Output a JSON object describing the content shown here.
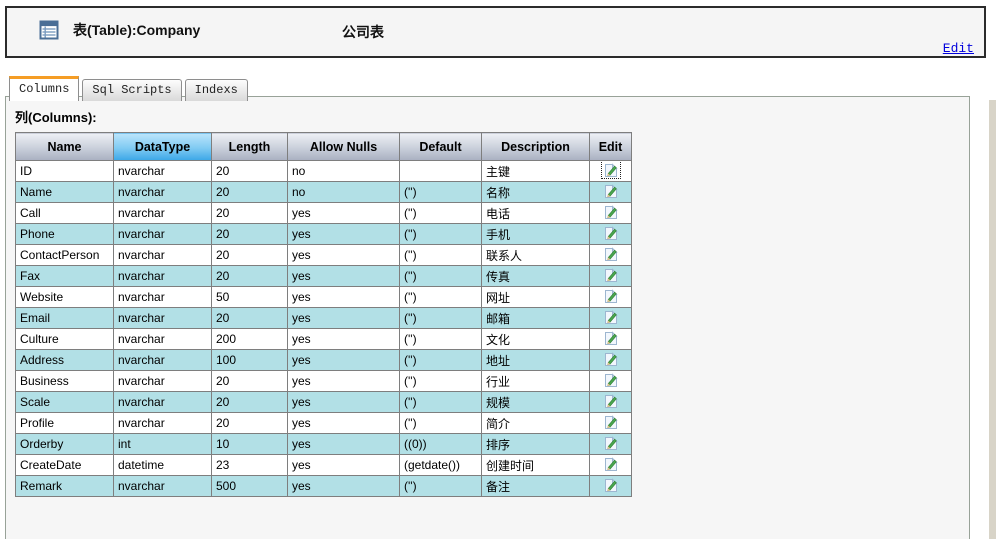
{
  "header": {
    "icon": "table-icon",
    "title": "表(Table):Company",
    "subtitle": "公司表",
    "edit_link": "Edit"
  },
  "tabs": [
    {
      "label": "Columns",
      "active": true
    },
    {
      "label": "Sql Scripts",
      "active": false
    },
    {
      "label": "Indexs",
      "active": false
    }
  ],
  "columns_section": {
    "label": "列(Columns):",
    "table": {
      "headers": [
        "Name",
        "DataType",
        "Length",
        "Allow Nulls",
        "Default",
        "Description",
        "Edit"
      ],
      "highlighted_header": "DataType",
      "focused_edit_row": 0,
      "rows": [
        {
          "name": "ID",
          "datatype": "nvarchar",
          "length": "20",
          "allow_nulls": "no",
          "default": "",
          "description": "主键"
        },
        {
          "name": "Name",
          "datatype": "nvarchar",
          "length": "20",
          "allow_nulls": "no",
          "default": "('')",
          "description": "名称"
        },
        {
          "name": "Call",
          "datatype": "nvarchar",
          "length": "20",
          "allow_nulls": "yes",
          "default": "('')",
          "description": "电话"
        },
        {
          "name": "Phone",
          "datatype": "nvarchar",
          "length": "20",
          "allow_nulls": "yes",
          "default": "('')",
          "description": "手机"
        },
        {
          "name": "ContactPerson",
          "datatype": "nvarchar",
          "length": "20",
          "allow_nulls": "yes",
          "default": "('')",
          "description": "联系人"
        },
        {
          "name": "Fax",
          "datatype": "nvarchar",
          "length": "20",
          "allow_nulls": "yes",
          "default": "('')",
          "description": "传真"
        },
        {
          "name": "Website",
          "datatype": "nvarchar",
          "length": "50",
          "allow_nulls": "yes",
          "default": "('')",
          "description": "网址"
        },
        {
          "name": "Email",
          "datatype": "nvarchar",
          "length": "20",
          "allow_nulls": "yes",
          "default": "('')",
          "description": "邮箱"
        },
        {
          "name": "Culture",
          "datatype": "nvarchar",
          "length": "200",
          "allow_nulls": "yes",
          "default": "('')",
          "description": "文化"
        },
        {
          "name": "Address",
          "datatype": "nvarchar",
          "length": "100",
          "allow_nulls": "yes",
          "default": "('')",
          "description": "地址"
        },
        {
          "name": "Business",
          "datatype": "nvarchar",
          "length": "20",
          "allow_nulls": "yes",
          "default": "('')",
          "description": "行业"
        },
        {
          "name": "Scale",
          "datatype": "nvarchar",
          "length": "20",
          "allow_nulls": "yes",
          "default": "('')",
          "description": "规模"
        },
        {
          "name": "Profile",
          "datatype": "nvarchar",
          "length": "20",
          "allow_nulls": "yes",
          "default": "('')",
          "description": "简介"
        },
        {
          "name": "Orderby",
          "datatype": "int",
          "length": "10",
          "allow_nulls": "yes",
          "default": "((0))",
          "description": "排序"
        },
        {
          "name": "CreateDate",
          "datatype": "datetime",
          "length": "23",
          "allow_nulls": "yes",
          "default": "(getdate())",
          "description": "创建时间"
        },
        {
          "name": "Remark",
          "datatype": "nvarchar",
          "length": "500",
          "allow_nulls": "yes",
          "default": "('')",
          "description": "备注"
        }
      ]
    }
  },
  "colors": {
    "alt_row": "#b2e0e6",
    "header_gray_top": "#eef0f5",
    "header_gray_bottom": "#a9b0c1",
    "header_blue_top": "#bce5fb",
    "header_blue_bottom": "#3ba7e7",
    "tab_accent": "#f59d25",
    "link": "#0000dd"
  }
}
